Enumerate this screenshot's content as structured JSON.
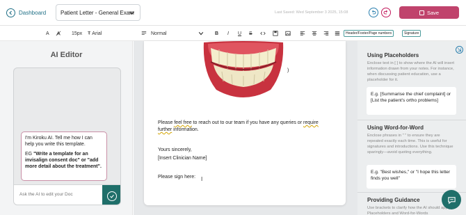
{
  "topbar": {
    "back_label": "Dashboard",
    "document_title": "Patient Letter - General Exam",
    "last_saved": "Last Saved: Wed September 3 2025, 15:08",
    "save_label": "Save"
  },
  "toolbar": {
    "text_color_label": "A",
    "font_size": "15px",
    "font_family": "Arial",
    "style": "Normal",
    "tag_header_footer": "Header/Footer/Page numbers",
    "tag_signature": "Signature"
  },
  "ai_editor": {
    "title": "AI Editor",
    "bubble_intro": "I'm Kiroku AI. Tell me how I can help you write this template.",
    "bubble_eg_prefix": "EG ",
    "bubble_eg_text": "\"Write a template for an invisalign consent doc\" or \"add more detail about the treatment\".",
    "input_placeholder": "Ask the AI to edit your Doc"
  },
  "document": {
    "para1_a": "Please ",
    "para1_b": "feel free",
    "para1_c": " to reach out to our team if you have any queries or ",
    "para1_d": "require",
    "para1_e": "further",
    "para1_f": " information.",
    "closing": "Yours sincerely,",
    "clinician": "[Insert Clinician Name]",
    "sign": "Please sign here:"
  },
  "tips": {
    "placeholders_title": "Using Placeholders",
    "placeholders_body": "Enclose text in [ ] to show where the AI will insert information drawn from your notes. For instance, when discussing patient education, use a placeholder for it.",
    "placeholders_example": "E.g. [Summarise the chief complaint] or [List the patient's ortho problems]",
    "wordforword_title": "Using Word-for-Word",
    "wordforword_body": "Enclose phrases in \" \" to ensure they are repeated exactly each time. This is useful for signatures and introductions. Use this technique sparingly—avoid quoting everything.",
    "wordforword_example": "E.g. \"Best wishes,\" or \"I hope this letter finds you well\"",
    "guidance_title": "Providing Guidance",
    "guidance_body": "Use brackets to clarify how the AI should apply Placeholders and Word-for-Words"
  },
  "colors": {
    "brand_teal": "#1f6f6a",
    "save_pink": "#c0436c",
    "link_blue": "#1f6f86"
  }
}
